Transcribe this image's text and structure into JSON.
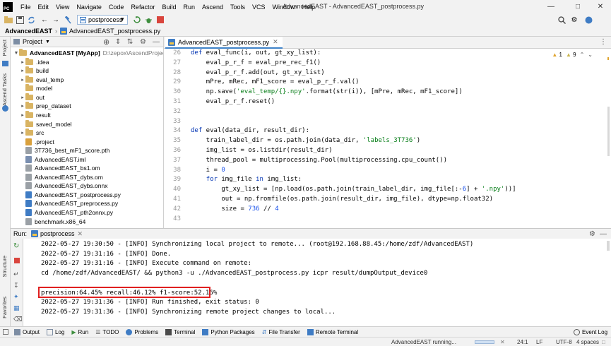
{
  "menu": [
    "File",
    "Edit",
    "View",
    "Navigate",
    "Code",
    "Refactor",
    "Build",
    "Run",
    "Ascend",
    "Tools",
    "VCS",
    "Window",
    "Help"
  ],
  "window_title": "AdvancedEAST - AdvancedEAST_postprocess.py",
  "toolbar": {
    "run_config": "postprocess"
  },
  "breadcrumb": {
    "project": "AdvancedEAST",
    "file": "AdvancedEAST_postprocess.py"
  },
  "left_stripe": {
    "project": "Project",
    "ascend_tasks": "Ascend Tasks",
    "structure": "Structure",
    "favorites": "Favorites"
  },
  "project_panel": {
    "title": "Project",
    "root_name": "AdvancedEAST [MyApp]",
    "root_path": "D:\\zepox\\AscendProjects\\Adva",
    "items": [
      {
        "name": ".idea",
        "type": "folder",
        "expandable": true
      },
      {
        "name": "build",
        "type": "folder",
        "expandable": true
      },
      {
        "name": "eval_temp",
        "type": "folder",
        "expandable": true
      },
      {
        "name": "model",
        "type": "folder",
        "expandable": false
      },
      {
        "name": "out",
        "type": "folder",
        "expandable": true
      },
      {
        "name": "prep_dataset",
        "type": "folder",
        "expandable": true
      },
      {
        "name": "result",
        "type": "folder",
        "expandable": true
      },
      {
        "name": "saved_model",
        "type": "folder",
        "expandable": false
      },
      {
        "name": "src",
        "type": "folder",
        "expandable": true
      },
      {
        "name": ".project",
        "type": "file",
        "color": "#d9a03c"
      },
      {
        "name": "3T736_best_mF1_score.pth",
        "type": "file",
        "color": "#9aa0a6"
      },
      {
        "name": "AdvancedEAST.iml",
        "type": "file",
        "color": "#7a8fb0"
      },
      {
        "name": "AdvancedEAST_bs1.om",
        "type": "file",
        "color": "#9aa0a6"
      },
      {
        "name": "AdvancedEAST_dybs.om",
        "type": "file",
        "color": "#9aa0a6"
      },
      {
        "name": "AdvancedEAST_dybs.onnx",
        "type": "file",
        "color": "#9aa0a6"
      },
      {
        "name": "AdvancedEAST_postprocess.py",
        "type": "file",
        "color": "#3f7cc4"
      },
      {
        "name": "AdvancedEAST_preprocess.py",
        "type": "file",
        "color": "#3f7cc4"
      },
      {
        "name": "AdvancedEAST_pth2onnx.py",
        "type": "file",
        "color": "#3f7cc4"
      },
      {
        "name": "benchmark.x86_64",
        "type": "file",
        "color": "#9aa0a6"
      }
    ]
  },
  "editor": {
    "tab": "AdvancedEAST_postprocess.py",
    "warnings": "1",
    "weak_warnings": "9",
    "line_numbers": [
      "26",
      "27",
      "28",
      "29",
      "30",
      "31",
      "32",
      "33",
      "34",
      "35",
      "36",
      "37",
      "38",
      "39",
      "40",
      "41",
      "42",
      "43"
    ],
    "lines": [
      "def eval_func(i, out, gt_xy_list):",
      "    eval_p_r_f = eval_pre_rec_f1()",
      "    eval_p_r_f.add(out, gt_xy_list)",
      "    mPre, mRec, mF1_score = eval_p_r_f.val()",
      "    np.save('eval_temp/{}.npy'.format(str(i)), [mPre, mRec, mF1_score])",
      "    eval_p_r_f.reset()",
      "",
      "",
      "def eval(data_dir, result_dir):",
      "    train_label_dir = os.path.join(data_dir, 'labels_3T736')",
      "    img_list = os.listdir(result_dir)",
      "    thread_pool = multiprocessing.Pool(multiprocessing.cpu_count())",
      "    i = 0",
      "    for img_file in img_list:",
      "        gt_xy_list = [np.load(os.path.join(train_label_dir, img_file[:-6] + '.npy'))]",
      "        out = np.fromfile(os.path.join(result_dir, img_file), dtype=np.float32)",
      "        size = 736 // 4",
      ""
    ]
  },
  "run_panel": {
    "label": "Run:",
    "tab": "postprocess",
    "lines": [
      "2022-05-27 19:30:50 - [INFO] Synchronizing local project to remote... (root@192.168.88.45:/home/zdf/AdvancedEAST)",
      "2022-05-27 19:31:16 - [INFO] Done.",
      "2022-05-27 19:31:16 - [INFO] Execute command on remote:",
      "cd /home/zdf/AdvancedEAST/ && python3 -u ./AdvancedEAST_postprocess.py icpr result/dumpOutput_device0",
      "",
      "precision:64.45% recall:46.12% f1-score:52.16%",
      "2022-05-27 19:31:36 - [INFO] Run finished, exit status: 0",
      "2022-05-27 19:31:36 - [INFO] Synchronizing remote project changes to local..."
    ]
  },
  "bottom_tabs": [
    "Output",
    "Log",
    "Run",
    "TODO",
    "Problems",
    "Terminal",
    "Python Packages",
    "File Transfer",
    "Remote Terminal"
  ],
  "event_log": "Event Log",
  "status": {
    "message": "AdvancedEAST running...",
    "position": "24:1",
    "line_sep": "LF",
    "encoding": "UTF-8",
    "indent": "4 spaces"
  }
}
